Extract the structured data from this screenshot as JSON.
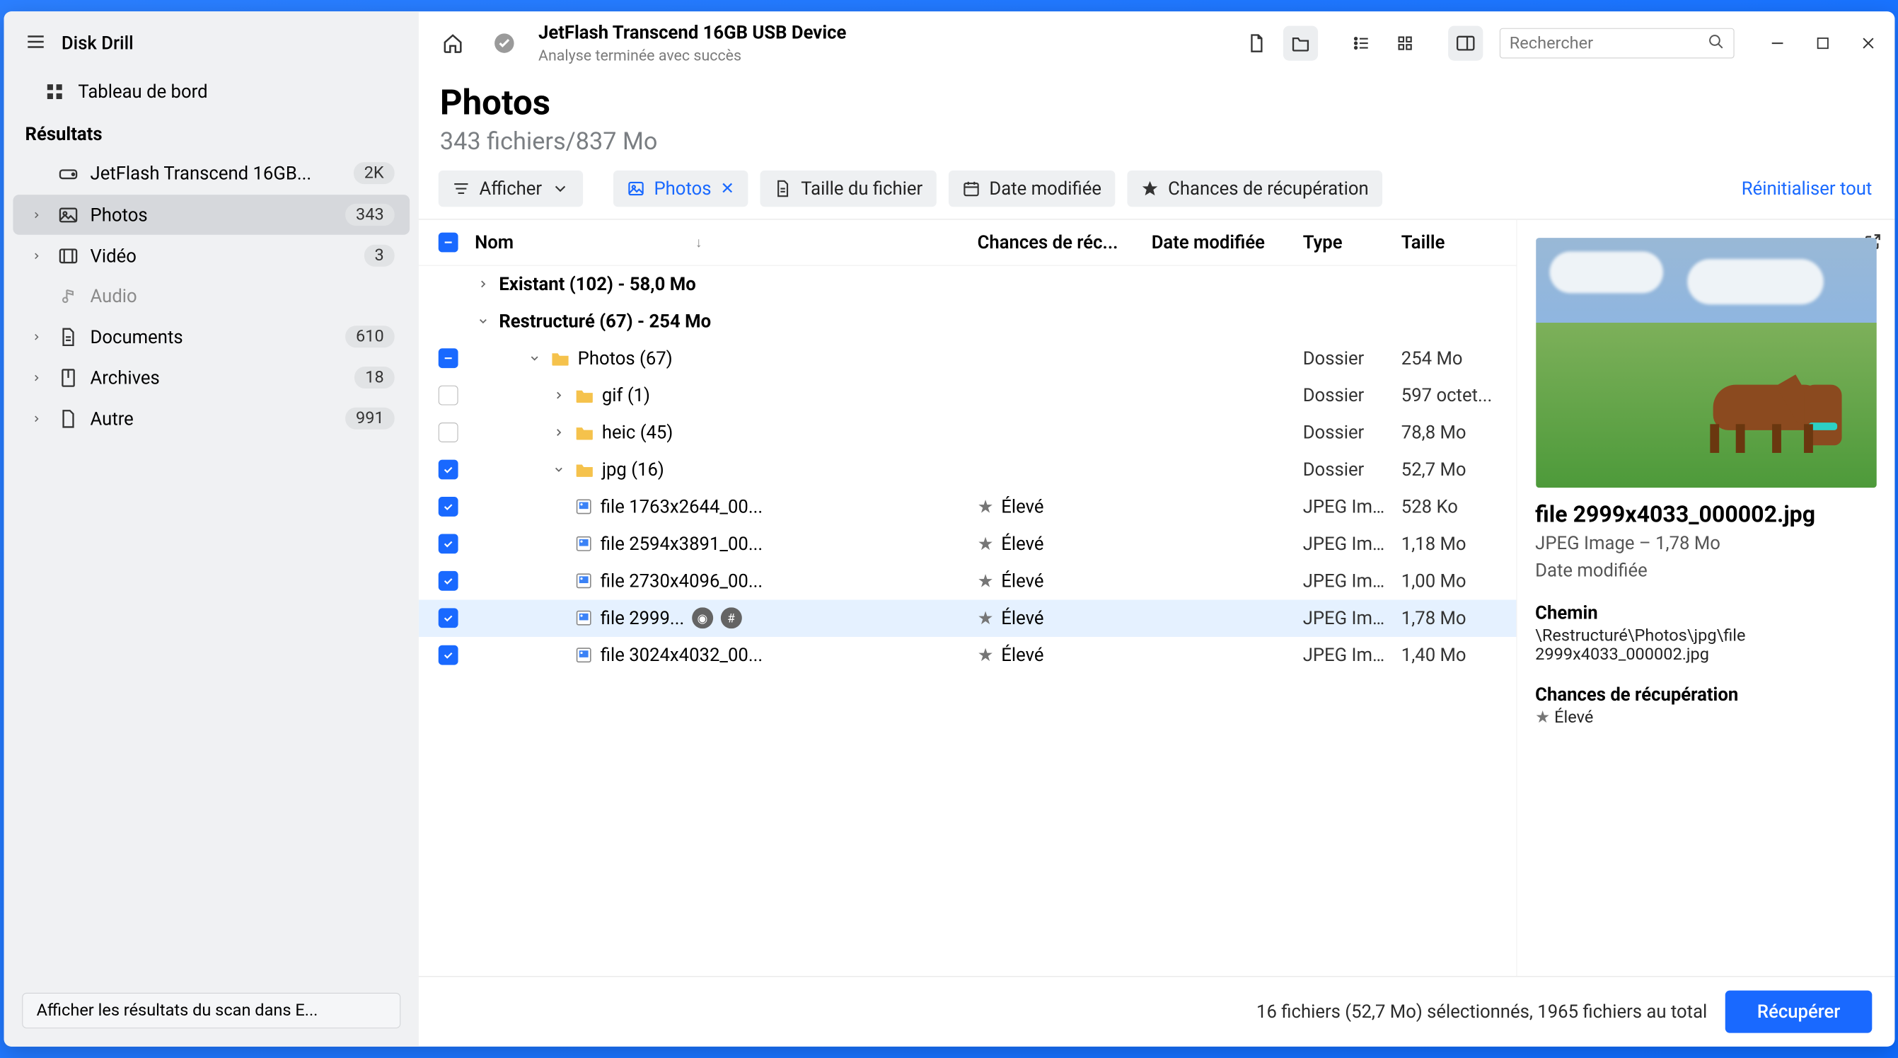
{
  "app": {
    "name": "Disk Drill"
  },
  "sidebar": {
    "dashboard": "Tableau de bord",
    "results_label": "Résultats",
    "device": {
      "label": "JetFlash Transcend 16GB...",
      "count": "2K"
    },
    "items": [
      {
        "label": "Photos",
        "count": "343",
        "icon": "image",
        "active": true
      },
      {
        "label": "Vidéo",
        "count": "3",
        "icon": "video",
        "active": false
      },
      {
        "label": "Audio",
        "count": "",
        "icon": "audio",
        "disabled": true
      },
      {
        "label": "Documents",
        "count": "610",
        "icon": "doc",
        "active": false
      },
      {
        "label": "Archives",
        "count": "18",
        "icon": "archive",
        "active": false
      },
      {
        "label": "Autre",
        "count": "991",
        "icon": "other",
        "active": false
      }
    ],
    "footer_button": "Afficher les résultats du scan dans E..."
  },
  "header": {
    "title": "JetFlash Transcend 16GB USB Device",
    "subtitle": "Analyse terminée avec succès",
    "search_placeholder": "Rechercher"
  },
  "page": {
    "title": "Photos",
    "subtitle": "343 fichiers/837 Mo"
  },
  "filters": {
    "show": "Afficher",
    "chips": [
      {
        "label": "Photos",
        "active": true,
        "icon": "image"
      },
      {
        "label": "Taille du fichier",
        "icon": "doc"
      },
      {
        "label": "Date modifiée",
        "icon": "calendar"
      },
      {
        "label": "Chances de récupération",
        "icon": "star"
      }
    ],
    "reset": "Réinitialiser tout"
  },
  "columns": {
    "name": "Nom",
    "rec": "Chances de réc...",
    "date": "Date modifiée",
    "type": "Type",
    "size": "Taille"
  },
  "groups": {
    "existant": "Existant (102) - 58,0 Mo",
    "restructure": "Restructuré (67) - 254 Mo"
  },
  "rows": [
    {
      "kind": "folder",
      "indent": 2,
      "chk": "ind",
      "name": "Photos (67)",
      "type": "Dossier",
      "size": "254 Mo",
      "expanded": true
    },
    {
      "kind": "folder",
      "indent": 3,
      "chk": "none",
      "name": "gif (1)",
      "type": "Dossier",
      "size": "597 octet...",
      "expanded": false
    },
    {
      "kind": "folder",
      "indent": 3,
      "chk": "none",
      "name": "heic (45)",
      "type": "Dossier",
      "size": "78,8 Mo",
      "expanded": false
    },
    {
      "kind": "folder",
      "indent": 3,
      "chk": "checked",
      "name": "jpg (16)",
      "type": "Dossier",
      "size": "52,7 Mo",
      "expanded": true
    },
    {
      "kind": "file",
      "indent": 4,
      "chk": "checked",
      "name": "file 1763x2644_00...",
      "rec": "Élevé",
      "type": "JPEG Im...",
      "size": "528 Ko"
    },
    {
      "kind": "file",
      "indent": 4,
      "chk": "checked",
      "name": "file 2594x3891_00...",
      "rec": "Élevé",
      "type": "JPEG Im...",
      "size": "1,18 Mo"
    },
    {
      "kind": "file",
      "indent": 4,
      "chk": "checked",
      "name": "file 2730x4096_00...",
      "rec": "Élevé",
      "type": "JPEG Im...",
      "size": "1,00 Mo"
    },
    {
      "kind": "file",
      "indent": 4,
      "chk": "checked",
      "name": "file 2999...",
      "rec": "Élevé",
      "type": "JPEG Im...",
      "size": "1,78 Mo",
      "selected": true,
      "extras": true
    },
    {
      "kind": "file",
      "indent": 4,
      "chk": "checked",
      "name": "file 3024x4032_00...",
      "rec": "Élevé",
      "type": "JPEG Im...",
      "size": "1,40 Mo"
    }
  ],
  "preview": {
    "name": "file 2999x4033_000002.jpg",
    "meta": "JPEG Image – 1,78 Mo",
    "date_label": "Date modifiée",
    "path_label": "Chemin",
    "path": "\\Restructuré\\Photos\\jpg\\file 2999x4033_000002.jpg",
    "rec_label": "Chances de récupération",
    "rec_value": "Élevé"
  },
  "status": {
    "text": "16 fichiers (52,7 Mo) sélectionnés, 1965 fichiers au total",
    "button": "Récupérer"
  }
}
